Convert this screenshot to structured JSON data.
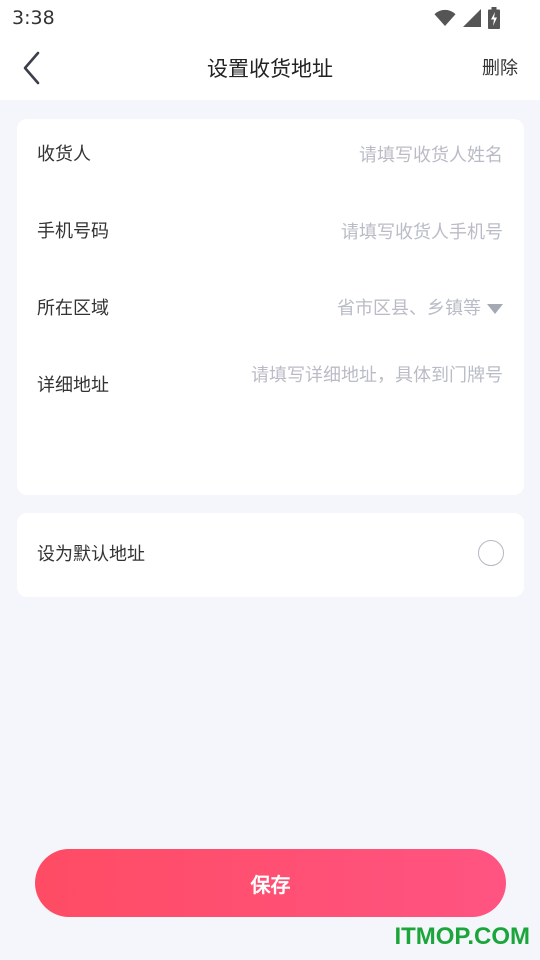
{
  "status_bar": {
    "time": "3:38",
    "icons": [
      "wifi-icon",
      "signal-icon",
      "battery-charging-icon"
    ]
  },
  "nav": {
    "back_icon": "chevron-left-icon",
    "title": "设置收货地址",
    "delete_label": "删除"
  },
  "form": {
    "recipient": {
      "label": "收货人",
      "value": "",
      "placeholder": "请填写收货人姓名"
    },
    "phone": {
      "label": "手机号码",
      "value": "",
      "placeholder": "请填写收货人手机号"
    },
    "region": {
      "label": "所在区域",
      "placeholder": "省市区县、乡镇等",
      "icon": "caret-down-icon"
    },
    "detail": {
      "label": "详细地址",
      "value": "",
      "placeholder": "请填写详细地址，具体到门牌号"
    }
  },
  "default_address": {
    "label": "设为默认地址",
    "checked": false
  },
  "save_label": "保存",
  "watermark": "ITMOP.COM",
  "colors": {
    "accent_start": "#ff4c64",
    "accent_end": "#ff5482",
    "page_background": "#f5f6fb",
    "placeholder": "#b9bcc6",
    "watermark": "#1aa63a"
  }
}
